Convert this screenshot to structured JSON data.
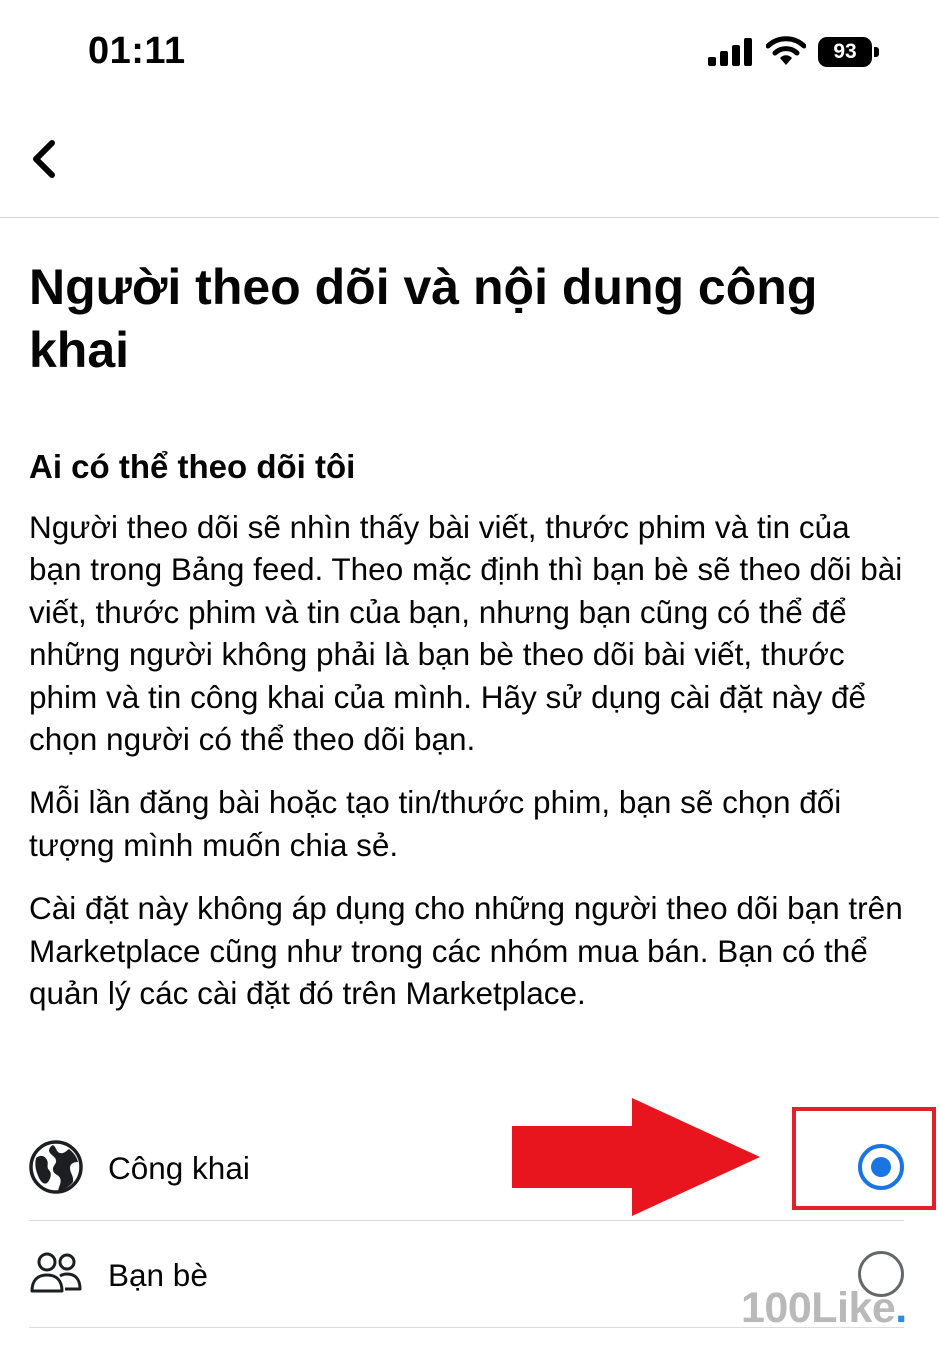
{
  "status_bar": {
    "time": "01:11",
    "battery": "93"
  },
  "nav": {
    "back_icon": "chevron-left-icon"
  },
  "page": {
    "title": "Người theo dõi và nội dung công khai",
    "section_heading": "Ai có thể theo dõi tôi",
    "paragraphs": [
      "Người theo dõi sẽ nhìn thấy bài viết, thước phim và tin của bạn trong Bảng feed. Theo mặc định thì bạn bè sẽ theo dõi bài viết, thước phim và tin của bạn, nhưng bạn cũng có thể để những người không phải là bạn bè theo dõi bài viết, thước phim và tin công khai của mình. Hãy sử dụng cài đặt này để chọn người có thể theo dõi bạn.",
      "Mỗi lần đăng bài hoặc tạo tin/thước phim, bạn sẽ chọn đối tượng mình muốn chia sẻ.",
      "Cài đặt này không áp dụng cho những người theo dõi bạn trên Marketplace cũng như trong các nhóm mua bán. Bạn có thể quản lý các cài đặt đó trên Marketplace."
    ]
  },
  "options": [
    {
      "label": "Công khai",
      "icon": "globe-icon",
      "selected": true
    },
    {
      "label": "Bạn bè",
      "icon": "friends-icon",
      "selected": false
    }
  ],
  "annotation": {
    "arrow_color": "#e8141e",
    "box_color": "#e0202a"
  },
  "watermark": {
    "text": "100Like",
    "dot": "."
  },
  "colors": {
    "accent": "#1b74e4",
    "text": "#050505",
    "divider": "#dcdcdc"
  }
}
